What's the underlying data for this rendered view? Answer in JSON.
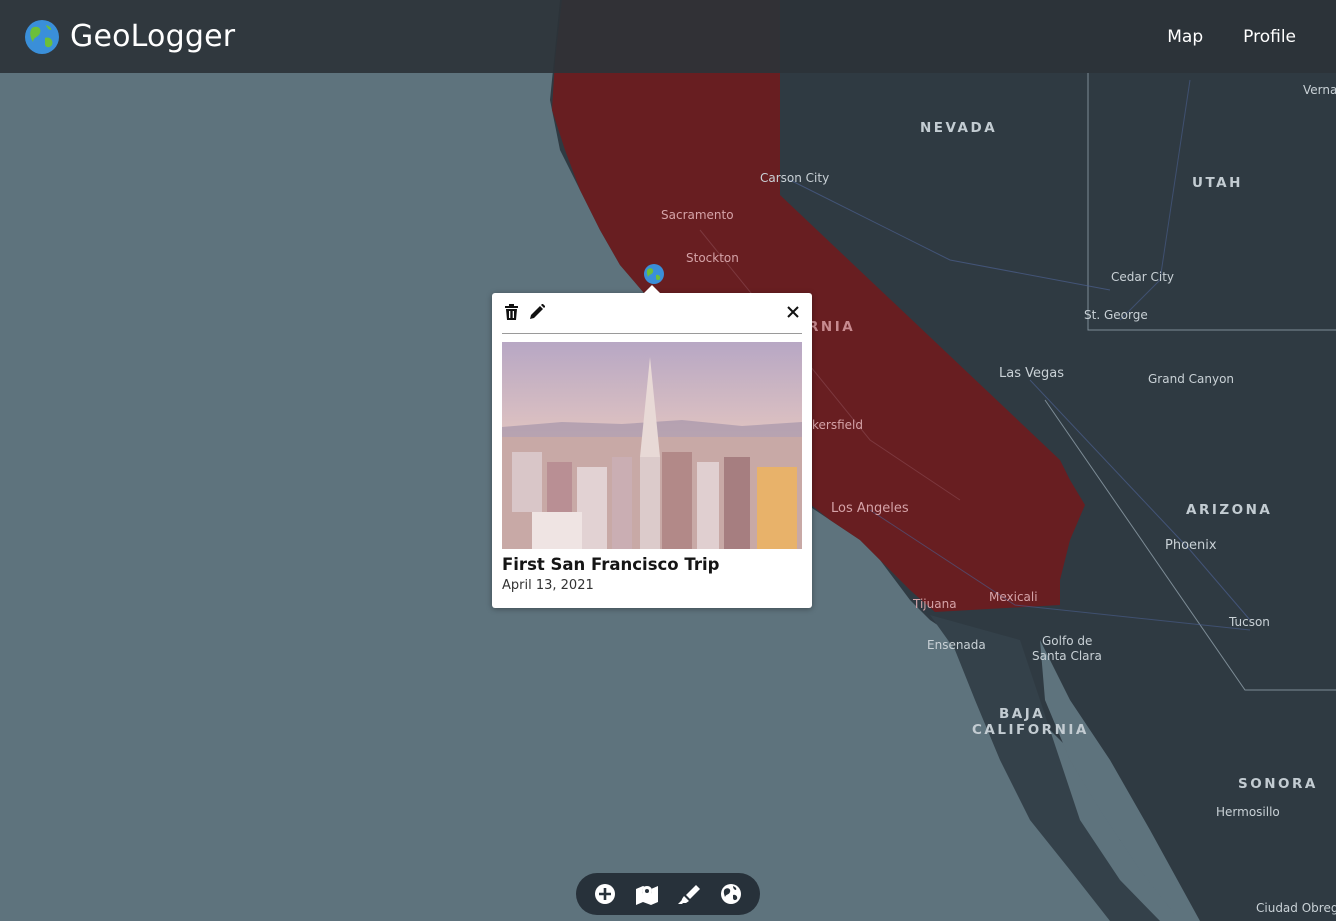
{
  "app": {
    "name": "GeoLogger",
    "logo_icon": "globe-americas-icon",
    "nav": [
      {
        "label": "Map"
      },
      {
        "label": "Profile"
      }
    ]
  },
  "colors": {
    "ocean": "#5e737d",
    "land": "#2f3a42",
    "highlight": "#6b1c20",
    "navbar": "#2c3338",
    "toolbar": "#27313a"
  },
  "map": {
    "highlighted_region": "California",
    "region_labels": [
      "NEVADA",
      "UTAH",
      "ARIZONA",
      "SONORA",
      "BAJA",
      "CALIFORNIA",
      "RNIA"
    ],
    "city_labels": [
      "Sacramento",
      "Stockton",
      "Carson City",
      "Cedar City",
      "St. George",
      "Las Vegas",
      "Grand Canyon",
      "Phoenix",
      "Tucson",
      "Los Angeles",
      "kersfield",
      "Tijuana",
      "Mexicali",
      "Ensenada",
      "Golfo de",
      "Santa Clara",
      "Hermosillo",
      "Ciudad Obregón",
      "Verna"
    ]
  },
  "popup": {
    "title": "First San Francisco Trip",
    "date": "April 13, 2021",
    "photo_icon": "city-skyline-photo",
    "actions": [
      {
        "name": "delete",
        "icon": "trash-icon"
      },
      {
        "name": "edit",
        "icon": "pencil-icon"
      }
    ],
    "close_icon": "close-icon"
  },
  "toolbar": {
    "buttons": [
      {
        "name": "add-log",
        "icon": "plus-circle-icon"
      },
      {
        "name": "map-view",
        "icon": "map-marker-icon"
      },
      {
        "name": "highlight",
        "icon": "highlighter-icon"
      },
      {
        "name": "globe-view",
        "icon": "globe-icon"
      }
    ]
  }
}
